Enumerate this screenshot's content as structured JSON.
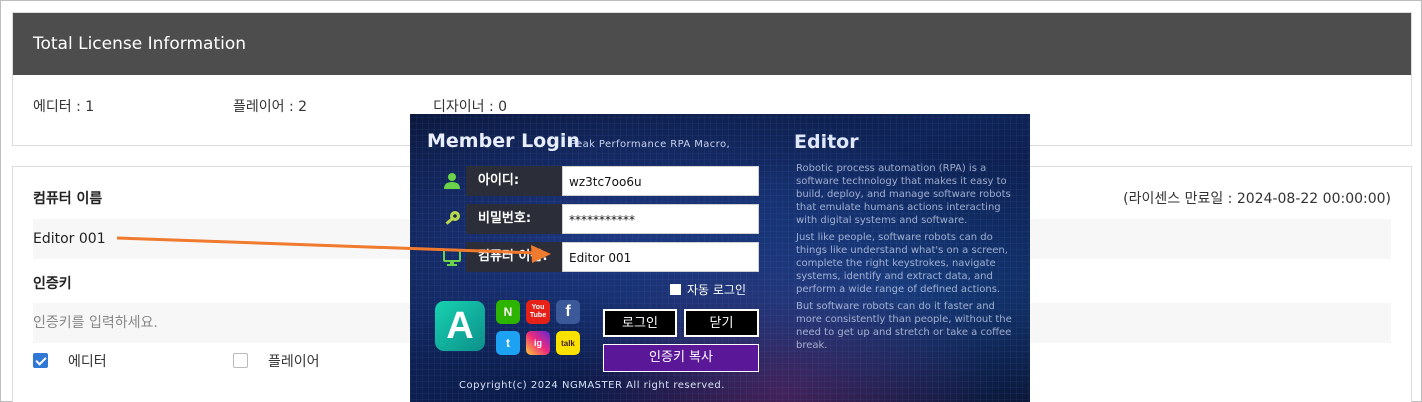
{
  "license": {
    "header": "Total License Information",
    "editor": "에디터 : 1",
    "player": "플레이어 : 2",
    "designer": "디자이너 : 0"
  },
  "form": {
    "computer_name_label": "컴퓨터 이름",
    "expiry": "(라이센스 만료일 : 2024-08-22 00:00:00)",
    "computer_name_value": "Editor 001",
    "auth_key_label": "인증키",
    "auth_key_placeholder": "인증키를 입력하세요.",
    "check_editor": "에디터",
    "check_player": "플레이어"
  },
  "login": {
    "title": "Member Login",
    "subtitle": "Peak Performance RPA Macro,",
    "id_label": "아이디:",
    "id_value": "wz3tc7oo6u",
    "pw_label": "비밀번호:",
    "pw_value": "***********",
    "pc_label": "컴퓨터 이름:",
    "pc_value": "Editor 001",
    "auto_login": "자동 로그인",
    "login_button": "로그인",
    "close_button": "닫기",
    "copy_key_button": "인증키 복사",
    "copyright": "Copyright(c) 2024 NGMASTER All right reserved.",
    "logo_letter": "A",
    "social": [
      "N",
      "You Tube",
      "f",
      "t",
      "ig",
      "talk"
    ],
    "editor_title": "Editor",
    "editor_paragraphs": [
      "Robotic process automation (RPA) is a software technology that makes it easy to build, deploy, and manage software robots that emulate humans actions interacting with digital systems and software.",
      "Just like people, software robots can do things like understand what's on a screen, complete the right keystrokes, navigate systems, identify and extract data, and perform a wide range of defined actions.",
      "But software robots can do it faster and more consistently than people, without the need to get up and stretch or take a coffee break."
    ]
  },
  "colors": {
    "header_bg": "#4d4d4d",
    "check_blue": "#2f78d6",
    "arrow": "#f07a2e",
    "copy_button": "#5a1899"
  }
}
